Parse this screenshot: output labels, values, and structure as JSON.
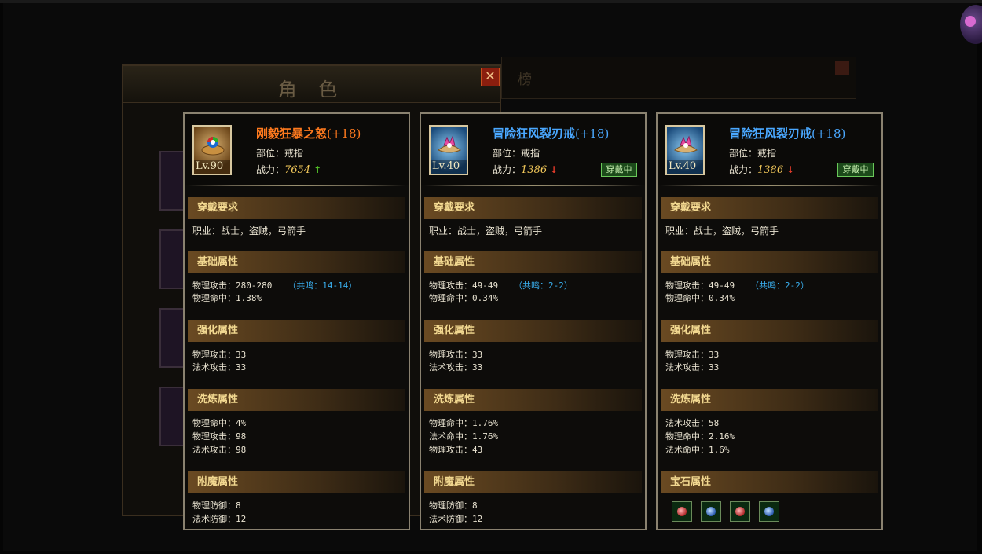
{
  "background_window": {
    "title": "角 色",
    "close_glyph": "✕",
    "rank_title": "榜"
  },
  "cards": [
    {
      "name": "刚毅狂暴之怒",
      "plus": "(+18)",
      "level": "Lv.90",
      "slot": "部位：戒指",
      "power_label": "战力：",
      "power": "7654",
      "power_arrow": "↑",
      "icon": "warrior-ring-icon",
      "sections": {
        "req_title": "穿戴要求",
        "req": "职业：战士，盗贼，弓箭手",
        "base_title": "基础属性",
        "base_1": "物理攻击：280-280",
        "base_1_res": "（共鸣：14-14）",
        "base_2": "物理命中：1.38%",
        "enh_title": "强化属性",
        "enh_1": "物理攻击：33",
        "enh_2": "法术攻击：33",
        "refine_title": "洗炼属性",
        "refine_1": "物理命中：4%",
        "refine_2": "物理攻击：98",
        "refine_3": "法术攻击：98",
        "ench_title": "附魔属性",
        "ench_1": "物理防御：8",
        "ench_2": "法术防御：12"
      }
    },
    {
      "name": "冒险狂风裂刃戒",
      "plus": "(+18)",
      "level": "Lv.40",
      "slot": "部位：戒指",
      "power_label": "战力：",
      "power": "1386",
      "power_arrow": "↓",
      "badge": "穿戴中",
      "icon": "adventure-ring-icon",
      "sections": {
        "req_title": "穿戴要求",
        "req": "职业：战士，盗贼，弓箭手",
        "base_title": "基础属性",
        "base_1": "物理攻击：49-49",
        "base_1_res": "（共鸣：2-2）",
        "base_2": "物理命中：0.34%",
        "enh_title": "强化属性",
        "enh_1": "物理攻击：33",
        "enh_2": "法术攻击：33",
        "refine_title": "洗炼属性",
        "refine_1": "物理命中：1.76%",
        "refine_2": "法术命中：1.76%",
        "refine_3": "物理攻击：43",
        "ench_title": "附魔属性",
        "ench_1": "物理防御：8",
        "ench_2": "法术防御：12"
      }
    },
    {
      "name": "冒险狂风裂刃戒",
      "plus": "(+18)",
      "level": "Lv.40",
      "slot": "部位：戒指",
      "power_label": "战力：",
      "power": "1386",
      "power_arrow": "↓",
      "badge": "穿戴中",
      "icon": "adventure-ring-icon",
      "sections": {
        "req_title": "穿戴要求",
        "req": "职业：战士，盗贼，弓箭手",
        "base_title": "基础属性",
        "base_1": "物理攻击：49-49",
        "base_1_res": "（共鸣：2-2）",
        "base_2": "物理命中：0.34%",
        "enh_title": "强化属性",
        "enh_1": "物理攻击：33",
        "enh_2": "法术攻击：33",
        "refine_title": "洗炼属性",
        "refine_1": "法术攻击：58",
        "refine_2": "物理命中：2.16%",
        "refine_3": "法术命中：1.6%",
        "gem_title": "宝石属性",
        "gems": [
          "red-gem-icon",
          "blue-gem-icon",
          "red-gem-icon",
          "blue-gem-icon"
        ]
      }
    }
  ],
  "colors": {
    "orange_name": "#ff7a1e",
    "blue_name": "#4aa8ff",
    "power_gold": "#f2c85a",
    "resonance": "#3ab0f0",
    "section_gold": "#f2d890"
  }
}
